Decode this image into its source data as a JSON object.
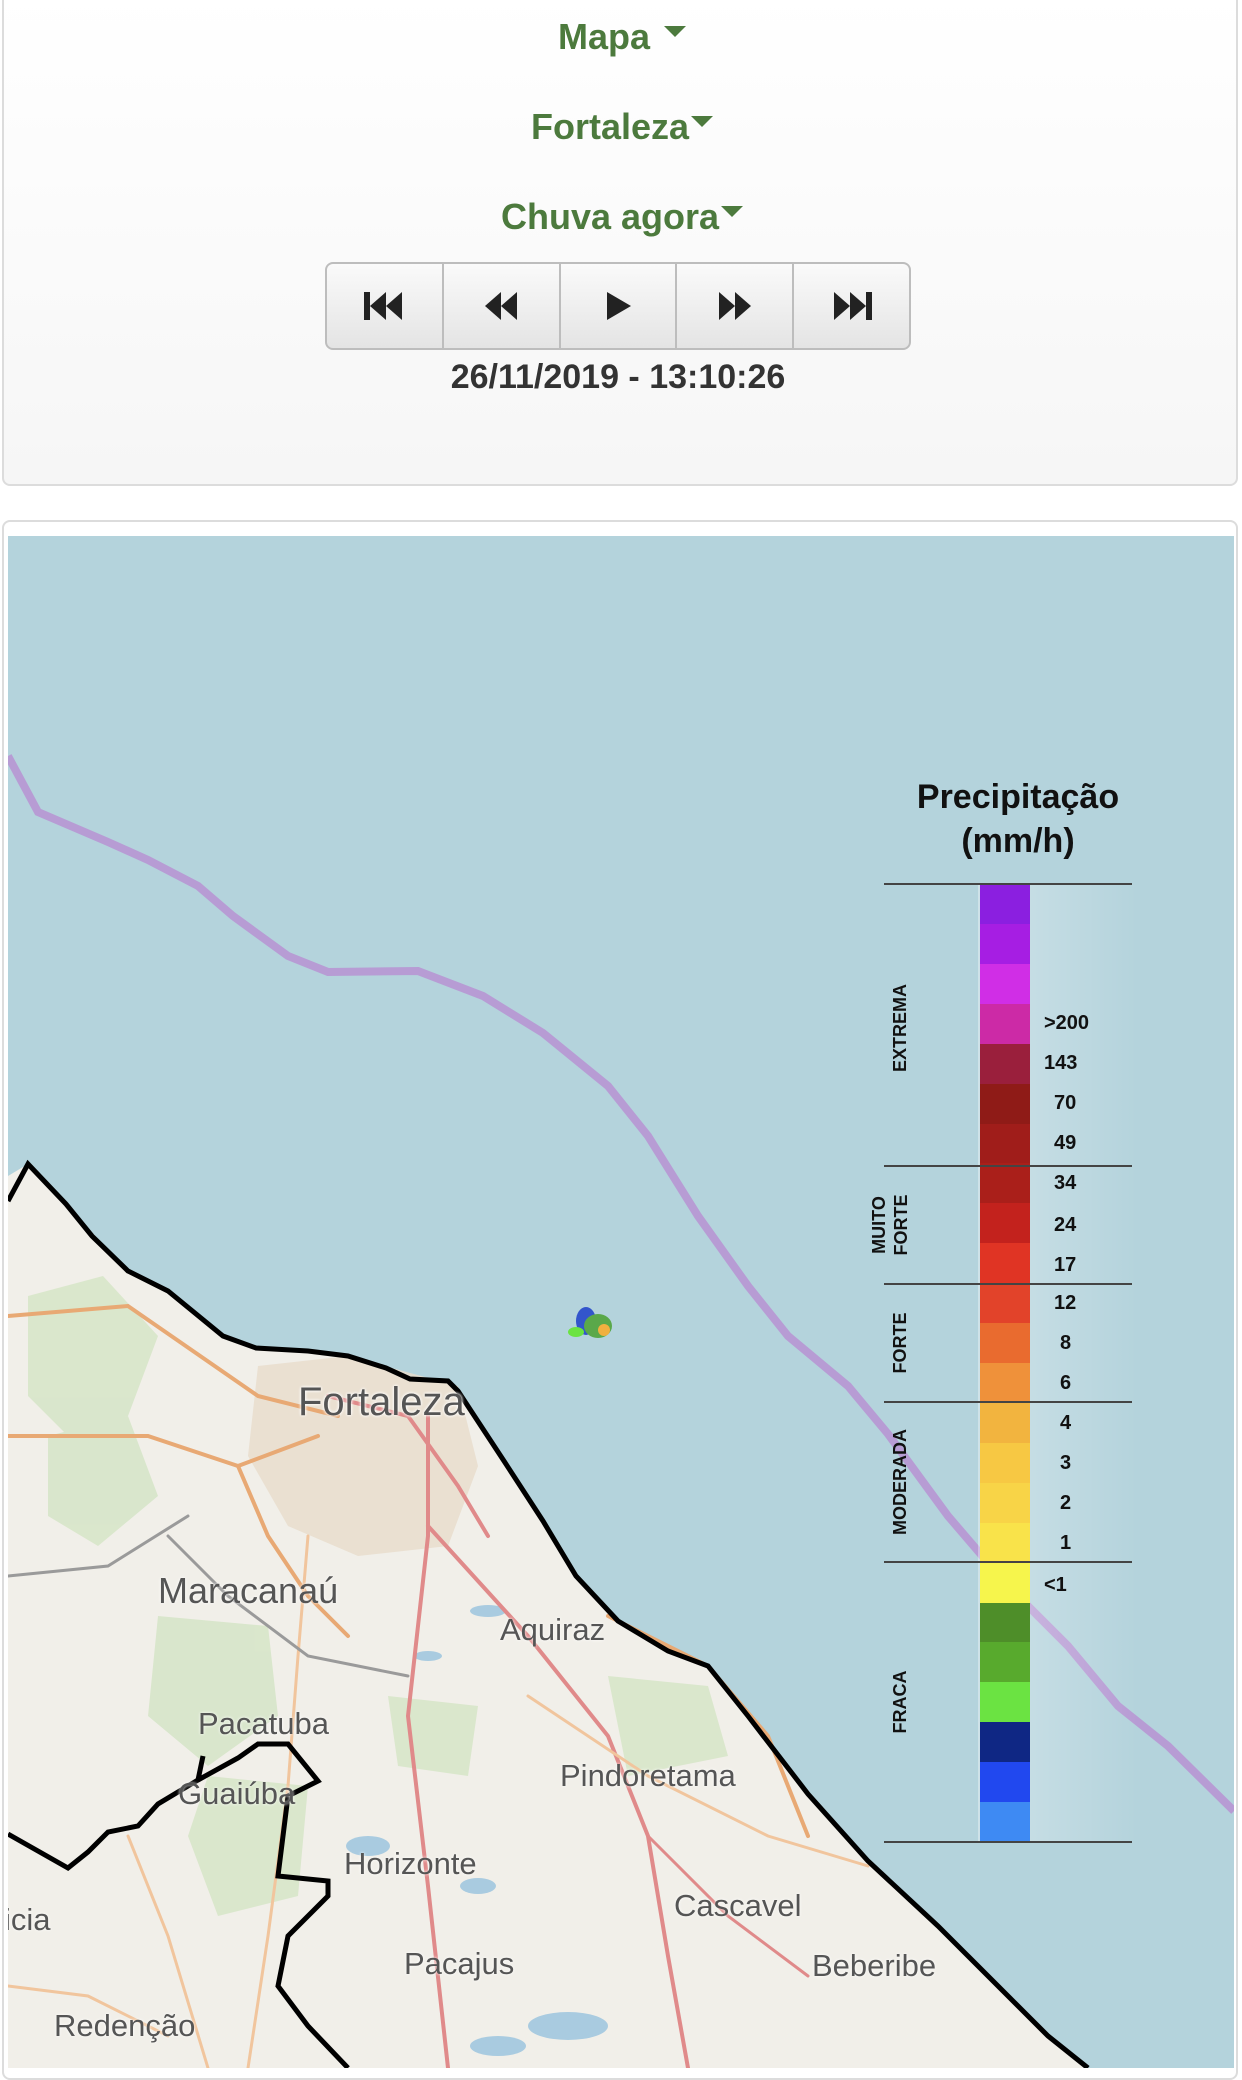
{
  "header": {
    "dropdown_map": "Mapa",
    "dropdown_city": "Fortaleza",
    "dropdown_product": "Chuva agora",
    "timestamp": "26/11/2019 - 13:10:26",
    "controls": [
      "first-frame-icon",
      "previous-frame-icon",
      "play-icon",
      "next-frame-icon",
      "last-frame-icon"
    ]
  },
  "map": {
    "labels": {
      "fortaleza": "Fortaleza",
      "maracanau": "Maracanaú",
      "aquiraz": "Aquiraz",
      "pacatuba": "Pacatuba",
      "guaiuba": "Guaiúba",
      "pindoretama": "Pindoretama",
      "horizonte": "Horizonte",
      "cascavel": "Cascavel",
      "icia": "icia",
      "pacajus": "Pacajus",
      "beberibe": "Beberibe",
      "redencao": "Redenção"
    },
    "colors": {
      "sea": "#b4d3dc",
      "land": "#f1efe9",
      "coast": "#000000",
      "route": "#b79cd4"
    }
  },
  "legend": {
    "title_line1": "Precipitação",
    "title_line2": "(mm/h)",
    "categories": {
      "extrema": "EXTREMA",
      "muito_forte": "MUITO FORTE",
      "forte": "FORTE",
      "moderada": "MODERADA",
      "fraca": "FRACA"
    },
    "values": {
      "v200": ">200",
      "v143": "143",
      "v70": "70",
      "v49": "49",
      "v34": "34",
      "v24": "24",
      "v17": "17",
      "v12": "12",
      "v8": "8",
      "v6": "6",
      "v4": "4",
      "v3": "3",
      "v2": "2",
      "v1": "1",
      "vlt1": "<1"
    },
    "colors": [
      "#8b1fe0",
      "#a61ee3",
      "#d02ee6",
      "#cc2aa6",
      "#9a1f3c",
      "#8f1b17",
      "#a01d1a",
      "#aa1f1a",
      "#c3221d",
      "#e03424",
      "#e2432a",
      "#e96b2f",
      "#ef913a",
      "#f2b43f",
      "#f7c843",
      "#f8d447",
      "#f9e34a",
      "#f6f54c",
      "#4e8e29",
      "#58aa2d",
      "#6be342",
      "#0f2784",
      "#2148ef",
      "#3e8af3"
    ]
  }
}
